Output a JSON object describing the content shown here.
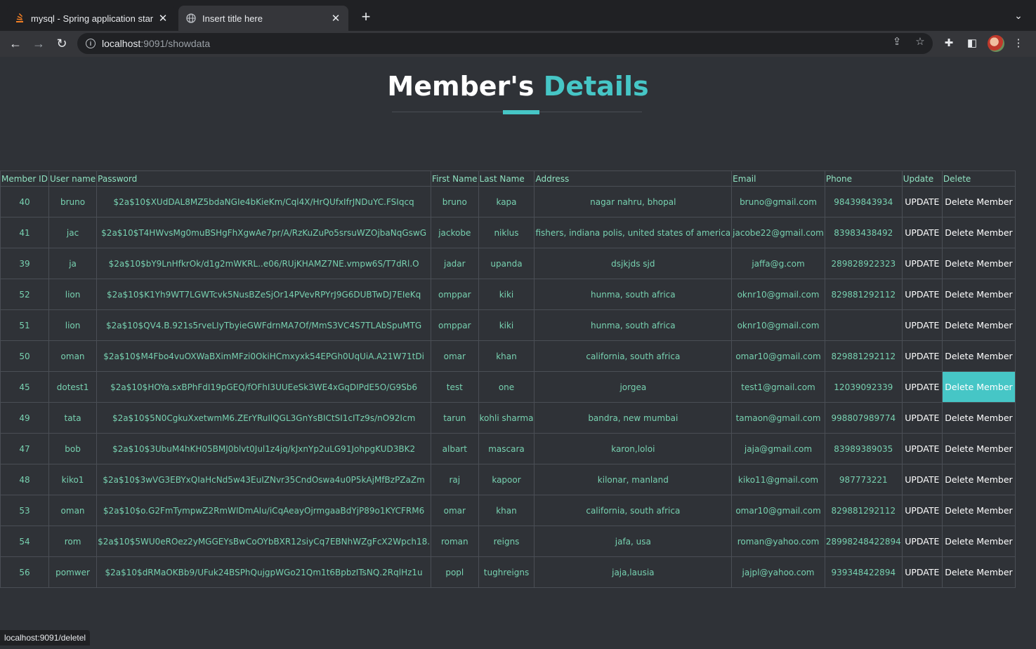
{
  "browser": {
    "tabs": [
      {
        "title": "mysql - Spring application star",
        "active": false,
        "favicon": "stackoverflow-icon"
      },
      {
        "title": "Insert title here",
        "active": true,
        "favicon": "globe-icon"
      }
    ],
    "url_host": "localhost",
    "url_path": ":9091/showdata",
    "status_text": "localhost:9091/deletel"
  },
  "page": {
    "title_main": "Member's ",
    "title_accent": "Details",
    "accent_color": "#46c6c6"
  },
  "table": {
    "headers": [
      "Member ID",
      "User name",
      "Password",
      "First Name",
      "Last Name",
      "Address",
      "Email",
      "Phone",
      "Update",
      "Delete"
    ],
    "update_label": "UPDATE",
    "delete_label": "Delete Member",
    "rows": [
      {
        "id": "40",
        "username": "bruno",
        "password": "$2a$10$XUdDAL8MZ5bdaNGIe4bKieKm/Cql4X/HrQUfxIfrJNDuYC.FSIqcq",
        "first": "bruno",
        "last": "kapa",
        "address": "nagar nahru, bhopal",
        "email": "bruno@gmail.com",
        "phone": "98439843934"
      },
      {
        "id": "41",
        "username": "jac",
        "password": "$2a$10$T4HWvsMg0muBSHgFhXgwAe7pr/A/RzKuZuPo5srsuWZOjbaNqGswG",
        "first": "jackobe",
        "last": "niklus",
        "address": "fishers, indiana polis, united states of america",
        "email": "jacobe22@gmail.com",
        "phone": "83983438492"
      },
      {
        "id": "39",
        "username": "ja",
        "password": "$2a$10$bY9LnHfkrOk/d1g2mWKRL..e06/RUjKHAMZ7NE.vmpw6S/T7dRl.O",
        "first": "jadar",
        "last": "upanda",
        "address": "dsjkjds sjd",
        "email": "jaffa@g.com",
        "phone": "289828922323"
      },
      {
        "id": "52",
        "username": "lion",
        "password": "$2a$10$K1Yh9WT7LGWTcvk5NusBZeSjOr14PVevRPYrJ9G6DUBTwDJ7EIeKq",
        "first": "omppar",
        "last": "kiki",
        "address": "hunma, south africa",
        "email": "oknr10@gmail.com",
        "phone": "829881292112"
      },
      {
        "id": "51",
        "username": "lion",
        "password": "$2a$10$QV4.B.921s5rveLIyTbyieGWFdrnMA7Of/MmS3VC4S7TLAbSpuMTG",
        "first": "omppar",
        "last": "kiki",
        "address": "hunma, south africa",
        "email": "oknr10@gmail.com",
        "phone": ""
      },
      {
        "id": "50",
        "username": "oman",
        "password": "$2a$10$M4Fbo4vuOXWaBXimMFzi0OkiHCmxyxk54EPGh0UqUiA.A21W71tDi",
        "first": "omar",
        "last": "khan",
        "address": "california, south africa",
        "email": "omar10@gmail.com",
        "phone": "829881292112"
      },
      {
        "id": "45",
        "username": "dotest1",
        "password": "$2a$10$HOYa.sxBPhFdI19pGEQ/fOFhI3UUEeSk3WE4xGqDIPdE5O/G9Sb6",
        "first": "test",
        "last": "one",
        "address": "jorgea",
        "email": "test1@gmail.com",
        "phone": "12039092339"
      },
      {
        "id": "49",
        "username": "tata",
        "password": "$2a$10$5N0CgkuXxetwmM6.ZErYRuIlQGL3GnYsBICtSI1cITz9s/nO92Icm",
        "first": "tarun",
        "last": "kohli sharma",
        "address": "bandra, new mumbai",
        "email": "tamaon@gmail.com",
        "phone": "998807989774"
      },
      {
        "id": "47",
        "username": "bob",
        "password": "$2a$10$3UbuM4hKH05BMJ0blvt0Jul1z4jq/kJxnYp2uLG91JohpgKUD3BK2",
        "first": "albart",
        "last": "mascara",
        "address": "karon,loloi",
        "email": "jaja@gmail.com",
        "phone": "83989389035"
      },
      {
        "id": "48",
        "username": "kiko1",
        "password": "$2a$10$3wVG3EBYxQIaHcNd5w43EuIZNvr35CndOswa4u0P5kAjMfBzPZaZm",
        "first": "raj",
        "last": "kapoor",
        "address": "kilonar, manland",
        "email": "kiko11@gmail.com",
        "phone": "987773221"
      },
      {
        "id": "53",
        "username": "oman",
        "password": "$2a$10$o.G2FmTympwZ2RmWIDmAIu/iCqAeayOjrmgaaBdYjP89o1KYCFRM6",
        "first": "omar",
        "last": "khan",
        "address": "california, south africa",
        "email": "omar10@gmail.com",
        "phone": "829881292112"
      },
      {
        "id": "54",
        "username": "rom",
        "password": "$2a$10$5WU0eROez2yMGGEYsBwCoOYbBXR12siyCq7EBNhWZgFcX2Wpch18.",
        "first": "roman",
        "last": "reigns",
        "address": "jafa, usa",
        "email": "roman@yahoo.com",
        "phone": "28998248422894"
      },
      {
        "id": "56",
        "username": "pomwer",
        "password": "$2a$10$dRMaOKBb9/UFuk24BSPhQujgpWGo21Qm1t6BpbzITsNQ.2RqlHz1u",
        "first": "popl",
        "last": "tughreigns",
        "address": "jaja,lausia",
        "email": "jajpl@yahoo.com",
        "phone": "939348422894"
      }
    ],
    "highlighted_row_index": 6
  }
}
